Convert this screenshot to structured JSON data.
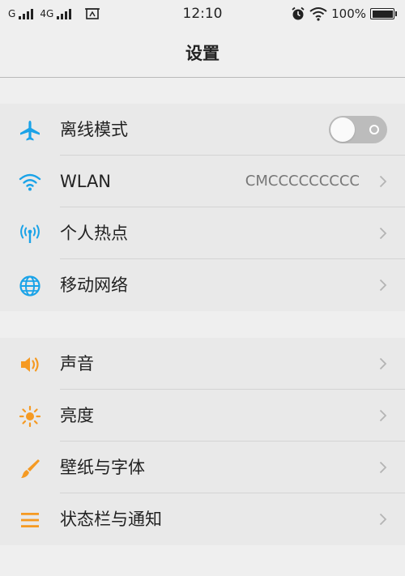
{
  "status_bar": {
    "carrier1": "G",
    "carrier2": "4G",
    "time": "12:10",
    "battery_pct": "100%"
  },
  "header": {
    "title": "设置"
  },
  "groups": [
    {
      "items": [
        {
          "label": "离线模式",
          "icon": "airplane-icon",
          "toggle": "off"
        },
        {
          "label": "WLAN",
          "icon": "wifi-icon",
          "value": "CMCCCCCCCCC"
        },
        {
          "label": "个人热点",
          "icon": "hotspot-icon"
        },
        {
          "label": "移动网络",
          "icon": "globe-icon"
        }
      ]
    },
    {
      "items": [
        {
          "label": "声音",
          "icon": "speaker-icon"
        },
        {
          "label": "亮度",
          "icon": "brightness-icon"
        },
        {
          "label": "壁纸与字体",
          "icon": "brush-icon"
        },
        {
          "label": "状态栏与通知",
          "icon": "list-icon"
        }
      ]
    }
  ],
  "colors": {
    "blue_icon": "#1aa3e8",
    "orange_icon": "#f59a23"
  }
}
